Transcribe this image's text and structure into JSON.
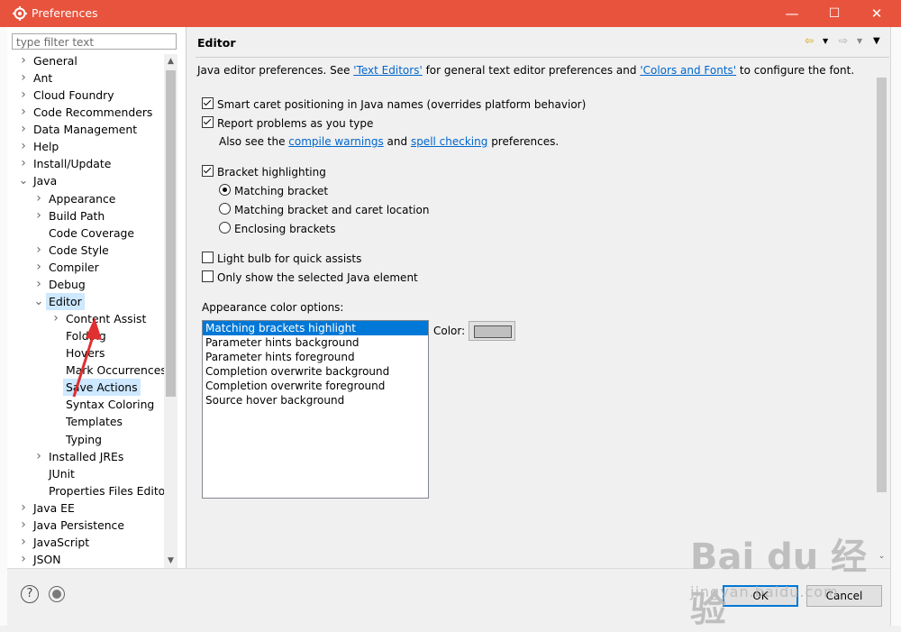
{
  "window": {
    "title": "Preferences",
    "controls": {
      "minimize": "—",
      "maximize": "☐",
      "close": "✕"
    }
  },
  "filter": {
    "placeholder": "type filter text"
  },
  "tree": [
    {
      "label": "General",
      "level": 0,
      "arrow": "right"
    },
    {
      "label": "Ant",
      "level": 0,
      "arrow": "right"
    },
    {
      "label": "Cloud Foundry",
      "level": 0,
      "arrow": "right"
    },
    {
      "label": "Code Recommenders",
      "level": 0,
      "arrow": "right"
    },
    {
      "label": "Data Management",
      "level": 0,
      "arrow": "right"
    },
    {
      "label": "Help",
      "level": 0,
      "arrow": "right"
    },
    {
      "label": "Install/Update",
      "level": 0,
      "arrow": "right"
    },
    {
      "label": "Java",
      "level": 0,
      "arrow": "down"
    },
    {
      "label": "Appearance",
      "level": 1,
      "arrow": "right"
    },
    {
      "label": "Build Path",
      "level": 1,
      "arrow": "right"
    },
    {
      "label": "Code Coverage",
      "level": 1,
      "arrow": ""
    },
    {
      "label": "Code Style",
      "level": 1,
      "arrow": "right"
    },
    {
      "label": "Compiler",
      "level": 1,
      "arrow": "right"
    },
    {
      "label": "Debug",
      "level": 1,
      "arrow": "right"
    },
    {
      "label": "Editor",
      "level": 1,
      "arrow": "down",
      "selected": true
    },
    {
      "label": "Content Assist",
      "level": 2,
      "arrow": "right"
    },
    {
      "label": "Folding",
      "level": 2,
      "arrow": ""
    },
    {
      "label": "Hovers",
      "level": 2,
      "arrow": ""
    },
    {
      "label": "Mark Occurrences",
      "level": 2,
      "arrow": ""
    },
    {
      "label": "Save Actions",
      "level": 2,
      "arrow": "",
      "selected": true
    },
    {
      "label": "Syntax Coloring",
      "level": 2,
      "arrow": ""
    },
    {
      "label": "Templates",
      "level": 2,
      "arrow": ""
    },
    {
      "label": "Typing",
      "level": 2,
      "arrow": ""
    },
    {
      "label": "Installed JREs",
      "level": 1,
      "arrow": "right"
    },
    {
      "label": "JUnit",
      "level": 1,
      "arrow": ""
    },
    {
      "label": "Properties Files Editor",
      "level": 1,
      "arrow": ""
    },
    {
      "label": "Java EE",
      "level": 0,
      "arrow": "right"
    },
    {
      "label": "Java Persistence",
      "level": 0,
      "arrow": "right"
    },
    {
      "label": "JavaScript",
      "level": 0,
      "arrow": "right"
    },
    {
      "label": "JSON",
      "level": 0,
      "arrow": "right"
    }
  ],
  "page": {
    "title": "Editor",
    "desc_prefix": "Java editor preferences. See ",
    "link_text_editors": "'Text Editors'",
    "desc_mid": " for general text editor preferences and ",
    "link_colors_fonts": "'Colors and Fonts'",
    "desc_suffix": " to configure the font.",
    "smart_caret": "Smart caret positioning in Java names (overrides platform behavior)",
    "report_problems": "Report problems as you type",
    "also_see_prefix": "Also see the ",
    "link_compile_warnings": "compile warnings",
    "also_see_and": " and ",
    "link_spell_checking": "spell checking",
    "also_see_suffix": " preferences.",
    "bracket_highlighting": "Bracket highlighting",
    "radio_matching": "Matching bracket",
    "radio_matching_caret": "Matching bracket and caret location",
    "radio_enclosing": "Enclosing brackets",
    "light_bulb": "Light bulb for quick assists",
    "only_show_selected": "Only show the selected Java element",
    "appearance_color_options": "Appearance color options:",
    "color_options": [
      "Matching brackets highlight",
      "Parameter hints background",
      "Parameter hints foreground",
      "Completion overwrite background",
      "Completion overwrite foreground",
      "Source hover background"
    ],
    "color_label": "Color:",
    "swatch_color": "#c0c0c0"
  },
  "buttons": {
    "ok": "OK",
    "cancel": "Cancel",
    "help": "?"
  },
  "watermark": {
    "line1": "Bai du 经验",
    "line2": "jingyan.baidu.com"
  },
  "colors": {
    "titlebar": "#e8533d",
    "selection": "#0078d7",
    "tree_selection": "#cde8ff",
    "link": "#0066cc",
    "annotation_arrow": "#e03030"
  }
}
